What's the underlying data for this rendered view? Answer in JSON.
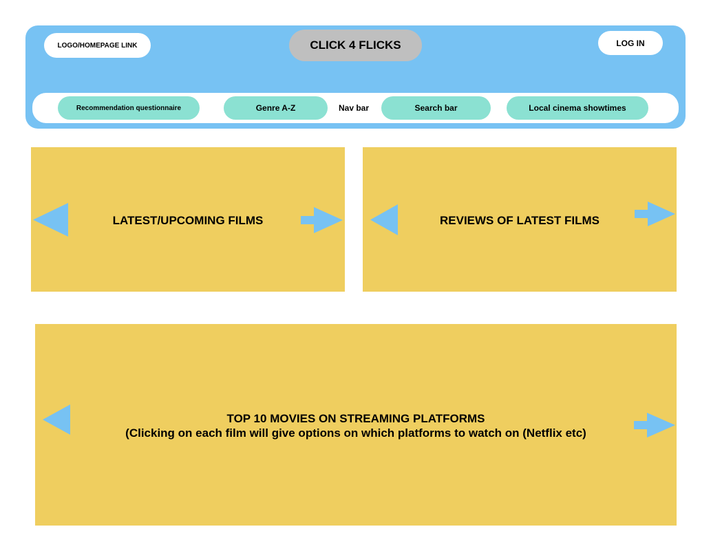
{
  "header": {
    "logo_link": "LOGO/HOMEPAGE LINK",
    "site_title": "CLICK 4 FLICKS",
    "login_label": "LOG IN"
  },
  "nav": {
    "label": "Nav bar",
    "items": [
      {
        "label": "Recommendation questionnaire"
      },
      {
        "label": "Genre A-Z"
      },
      {
        "label": "Search bar"
      },
      {
        "label": "Local cinema showtimes"
      }
    ]
  },
  "panels": {
    "latest": {
      "title": "LATEST/UPCOMING FILMS"
    },
    "reviews": {
      "title": "REVIEWS OF LATEST FILMS"
    },
    "top10": {
      "title": "TOP 10 MOVIES ON STREAMING PLATFORMS",
      "subtitle": "(Clicking on each film will give options on which platforms to watch on (Netflix etc)"
    }
  },
  "icons": {
    "prev": "arrow-left-icon",
    "next": "arrow-right-icon"
  },
  "colors": {
    "header_bg": "#77c2f3",
    "nav_pill": "#8be1d2",
    "title_pill": "#bfbfbf",
    "panel_bg": "#efce5f",
    "arrow": "#77c2f3"
  }
}
